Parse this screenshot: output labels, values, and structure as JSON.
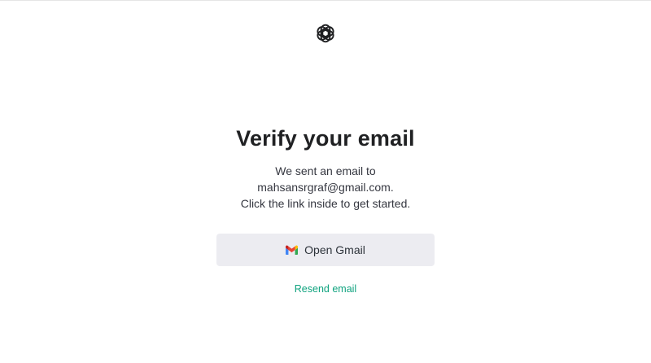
{
  "header": {
    "logo_icon": "openai-logo-icon"
  },
  "main": {
    "title": "Verify your email",
    "description": {
      "line1": "We sent an email to",
      "line2": "mahsansrgraf@gmail.com.",
      "line3": "Click the link inside to get started."
    },
    "open_gmail_button": {
      "label": "Open Gmail",
      "icon": "gmail-icon"
    },
    "resend_link": "Resend email"
  },
  "colors": {
    "accent": "#10a37f",
    "button_bg": "#ececf1",
    "title": "#202123"
  }
}
